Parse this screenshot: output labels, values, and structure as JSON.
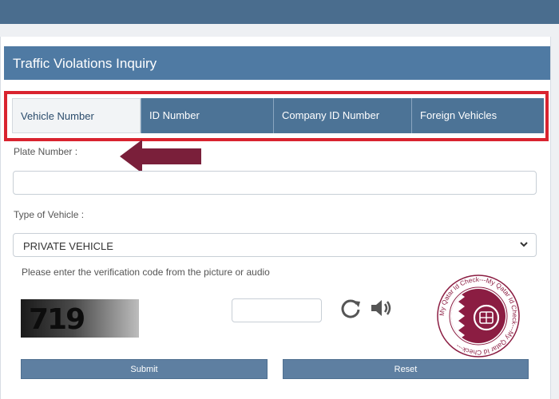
{
  "panel": {
    "title": "Traffic Violations Inquiry"
  },
  "tabs": [
    {
      "label": "Vehicle Number",
      "active": true
    },
    {
      "label": "ID Number",
      "active": false
    },
    {
      "label": "Company ID Number",
      "active": false
    },
    {
      "label": "Foreign Vehicles",
      "active": false
    }
  ],
  "form": {
    "plate_label": "Plate Number :",
    "plate_value": "",
    "vehicle_type_label": "Type of Vehicle :",
    "vehicle_type_value": "PRIVATE VEHICLE",
    "captcha_instruction": "Please enter the verification code from the picture or audio",
    "captcha_code": "719",
    "captcha_input_value": ""
  },
  "buttons": {
    "submit": "Submit",
    "reset": "Reset"
  },
  "stamp_text": "My Qatar Id Check---My Qatar Id Check---My Qatar Id Check---",
  "colors": {
    "header_blue": "#4f7aa3",
    "tab_blue": "#4c7396",
    "highlight_red": "#d9232f",
    "arrow_maroon": "#7a1f3a",
    "stamp_maroon": "#8b1d42"
  }
}
